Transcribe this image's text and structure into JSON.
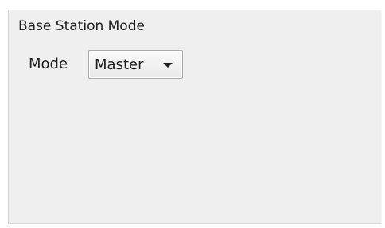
{
  "group": {
    "title": "Base Station Mode"
  },
  "mode": {
    "label": "Mode",
    "selected": "Master"
  },
  "icons": {
    "dropdown": "chevron-down-icon"
  }
}
